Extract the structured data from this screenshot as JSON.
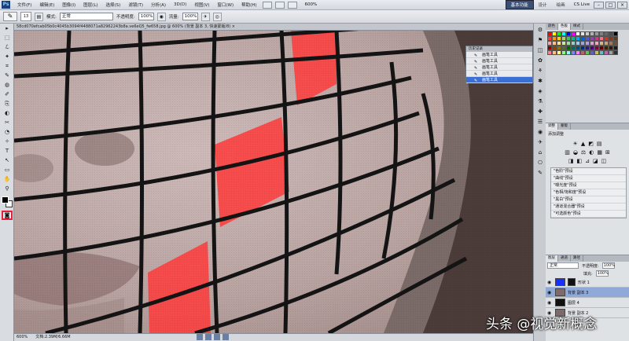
{
  "menubar": {
    "logo": "Ps",
    "items": [
      "文件(F)",
      "编辑(E)",
      "图像(I)",
      "图层(L)",
      "选择(S)",
      "滤镜(T)",
      "分析(A)",
      "3D(D)",
      "视图(V)",
      "窗口(W)",
      "帮助(H)"
    ],
    "zoom": "600%",
    "workspace_active": "基本功能",
    "workspace_items": [
      "设计",
      "绘画"
    ],
    "cs_live": "CS Live",
    "win_buttons": [
      "–",
      "□",
      "×"
    ]
  },
  "optbar": {
    "brush_size": "13",
    "mode_label": "模式:",
    "mode_value": "正常",
    "opacity_label": "不透明度:",
    "opacity_value": "100%",
    "flow_label": "流量:",
    "flow_value": "100%"
  },
  "tools": {
    "items": [
      "▸",
      "⬚",
      "ℒ",
      "✦",
      "⌗",
      "✎",
      "◍",
      "✐",
      "⎘",
      "◐",
      "✂",
      "◔",
      "✧",
      "T",
      "↖",
      "▭",
      "✋",
      "⚲"
    ],
    "quickmask": "◙"
  },
  "document": {
    "tab_title": "58cd070efcab05b0c4045b3094f4488071a82962243b8a.ve6eQ5_fw658.jpg @ 600% (背景 副本 3, 快速蒙版/8) × "
  },
  "status": {
    "zoom": "600%",
    "doc_info": "文档:2.39M/6.66M"
  },
  "history": {
    "header": "历史记录",
    "rows": [
      "画笔工具",
      "画笔工具",
      "画笔工具",
      "画笔工具",
      "画笔工具"
    ],
    "active_index": 4
  },
  "iconstrip": [
    "⚙",
    "⚑",
    "◫",
    "✿",
    "⚘",
    "✱",
    "◈",
    "⚗",
    "✚",
    "☰",
    "◉",
    "✈",
    "⌂",
    "⎔",
    "✎"
  ],
  "swatches_panel": {
    "tabs": [
      "颜色",
      "色板",
      "样式"
    ],
    "active_tab": "色板",
    "colors": [
      "#ff0000",
      "#ffff00",
      "#00ff00",
      "#00ffff",
      "#0000ff",
      "#ff00ff",
      "#ffffff",
      "#e6e6e6",
      "#cccccc",
      "#b3b3b3",
      "#999999",
      "#808080",
      "#666666",
      "#4d4d4d",
      "#000000",
      "#ff3b30",
      "#ff9500",
      "#ffcc00",
      "#a6d85c",
      "#34c759",
      "#00b894",
      "#00a8ff",
      "#0064d2",
      "#5856d6",
      "#8e44ad",
      "#d63384",
      "#ff6b81",
      "#c0392b",
      "#7f3b16",
      "#5a3e1b",
      "#f4a6a6",
      "#f9c28b",
      "#fbe38a",
      "#cfe6a0",
      "#9fdc9f",
      "#8fd3c7",
      "#9cc9f0",
      "#98a7e3",
      "#b79ce6",
      "#e09fd2",
      "#f2a7c3",
      "#d9b38c",
      "#c8a27a",
      "#a0785a",
      "#6b4f3a",
      "#8b0000",
      "#8b4500",
      "#8b7500",
      "#556b2f",
      "#006400",
      "#00695c",
      "#004d80",
      "#002b80",
      "#2e1a80",
      "#4b0082",
      "#800040",
      "#660000",
      "#3d2200",
      "#2b1b0e",
      "#1a1a1a",
      "#ff8080",
      "#ffc080",
      "#ffff80",
      "#80ff80",
      "#80ffff",
      "#8080ff",
      "#ff80ff",
      "#c06060",
      "#60c060",
      "#6060c0",
      "#c0c060",
      "#60c0c0",
      "#c060c0",
      "#a0a0a0",
      "#303030"
    ]
  },
  "adjust_panel": {
    "tabs": [
      "调整",
      "蒙版"
    ],
    "title": "添加调整",
    "icon_rows": [
      [
        "☀",
        "▲",
        "◩",
        "▤"
      ],
      [
        "▥",
        "◒",
        "⚖",
        "◐",
        "▦",
        "⊞"
      ],
      [
        "◨",
        "◧",
        "⊿",
        "◪",
        "◫"
      ]
    ],
    "presets": [
      "\"色阶\"预设",
      "\"曲线\"预设",
      "\"曝光度\"预设",
      "\"色相/饱和度\"预设",
      "\"黑白\"预设",
      "\"通道混合器\"预设",
      "\"可选颜色\"预设"
    ]
  },
  "layers_panel": {
    "tabs": [
      "图层",
      "通道",
      "路径"
    ],
    "blend_mode": "正常",
    "opacity_label": "不透明度:",
    "opacity_value": "100%",
    "fill_label": "填充:",
    "fill_value": "100%",
    "layers": [
      {
        "name": "形状 1",
        "thumb": "#1530ff",
        "has_mask": true
      },
      {
        "name": "背景 副本 3",
        "thumb": "#7e6a6a",
        "has_mask": false,
        "active": true
      },
      {
        "name": "图层 4",
        "thumb": "#111111",
        "has_mask": false
      },
      {
        "name": "背景 副本 2",
        "thumb": "#7e6a6a",
        "has_mask": false
      }
    ]
  },
  "watermark": "头条 @视觉新概念",
  "colors": {
    "mask_red": "#ff3b3b",
    "skin": "#bda9a7",
    "grid_line": "#141414",
    "highlight_border": "#e0233a"
  }
}
